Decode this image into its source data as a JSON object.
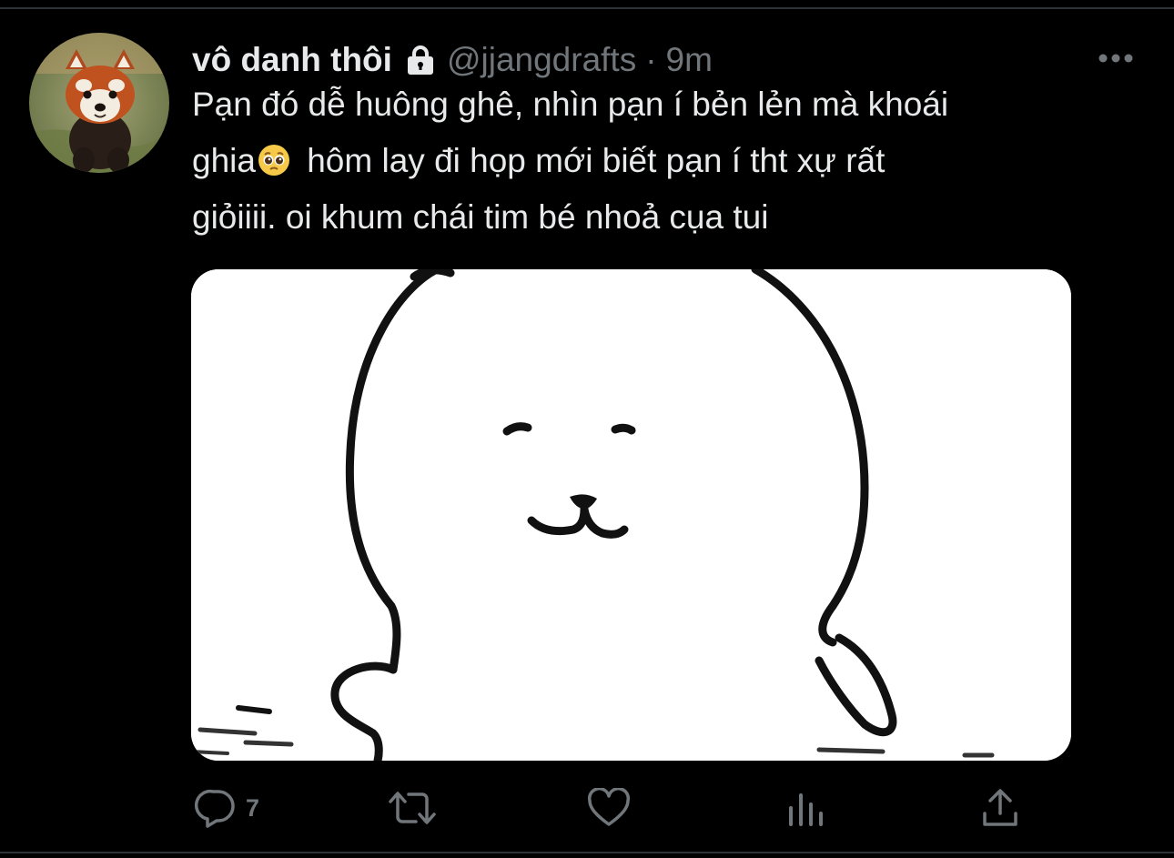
{
  "tweet": {
    "display_name": "vô danh thôi",
    "handle": "@jjangdrafts",
    "separator": "·",
    "timestamp": "9m",
    "text_lines": [
      "Pạn đó dễ huông ghê, nhìn pạn í bẻn lẻn mà khoái",
      "ghia",
      "hôm lay đi họp mới biết pạn í tht xự rất",
      "giỏiiii. oi khum chái tim bé nhoả cụa tui"
    ],
    "emoji": "pleading-face"
  },
  "actions": {
    "reply_count": "7"
  },
  "icons": {
    "lock": "lock-icon",
    "more": "more-horizontal-icon",
    "reply": "reply-icon",
    "retweet": "retweet-icon",
    "like": "heart-icon",
    "analytics": "analytics-icon",
    "share": "share-icon"
  },
  "colors": {
    "background": "#000000",
    "text_primary": "#e7e9ea",
    "text_secondary": "#71767b",
    "divider": "#2f3336"
  }
}
